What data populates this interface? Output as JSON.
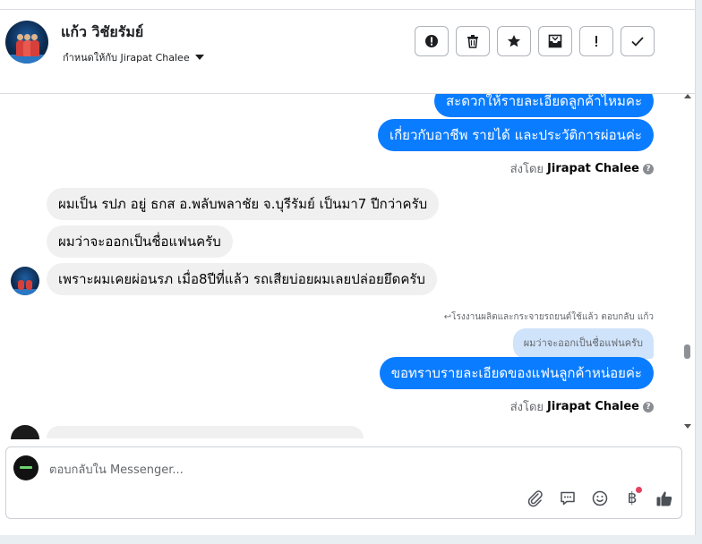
{
  "header": {
    "contact_name": "แก้ว วิชัยรัมย์",
    "assigned_to": "กำหนดให้กับ Jirapat Chalee",
    "actions": [
      {
        "name": "report-button",
        "icon": "alert-circle-icon",
        "glyph": "!"
      },
      {
        "name": "delete-button",
        "icon": "trash-icon"
      },
      {
        "name": "star-button",
        "icon": "star-icon"
      },
      {
        "name": "archive-button",
        "icon": "inbox-icon"
      },
      {
        "name": "mark-important-button",
        "icon": "exclamation-icon",
        "glyph": "!"
      },
      {
        "name": "mark-done-button",
        "icon": "check-icon"
      }
    ]
  },
  "chat": {
    "msg_out_1": "สะดวกให้รายละเอียดลูกค้าไหมคะ",
    "msg_out_2": "เกี่ยวกับอาชีพ รายได้ และประวัติการผ่อนค่ะ",
    "sent_by_prefix": "ส่งโดย",
    "sent_by_name": "Jirapat Chalee",
    "help_glyph": "?",
    "msg_in_1": "ผมเป็น รปภ อยู่ ธกส  อ.พลับพลาชัย จ.บุรีรัมย์  เป็นมา7 ปีกว่าครับ",
    "msg_in_2": "ผมว่าจะออกเป็นชื่อแฟนครับ",
    "msg_in_3": "เพราะผมเคยผ่อนรภ เมื่อ8ปีที่แล้ว  รถเสียบ่อยผมเลยปล่อยยึดครับ",
    "reply_note": "↩โรงงานผลิตและกระจายรถยนต์ใช้แล้ว ตอบกลับ แก้ว",
    "quoted_text": "ผมว่าจะออกเป็นชื่อแฟนครับ",
    "msg_out_3": "ขอทราบรายละเอียดของแฟนลูกค้าหน่อยค่ะ"
  },
  "composer": {
    "placeholder": "ตอบกลับใน Messenger...",
    "currency_glyph": "฿",
    "tools": [
      "paperclip-icon",
      "chat-bubble-icon",
      "smiley-icon",
      "baht-icon",
      "thumbs-up-icon"
    ]
  },
  "colors": {
    "outgoing_bubble": "#0a7cff",
    "incoming_bubble": "#f0f0f0",
    "quoted_bubble": "#cfe3fb",
    "notification_dot": "#e4405f"
  }
}
